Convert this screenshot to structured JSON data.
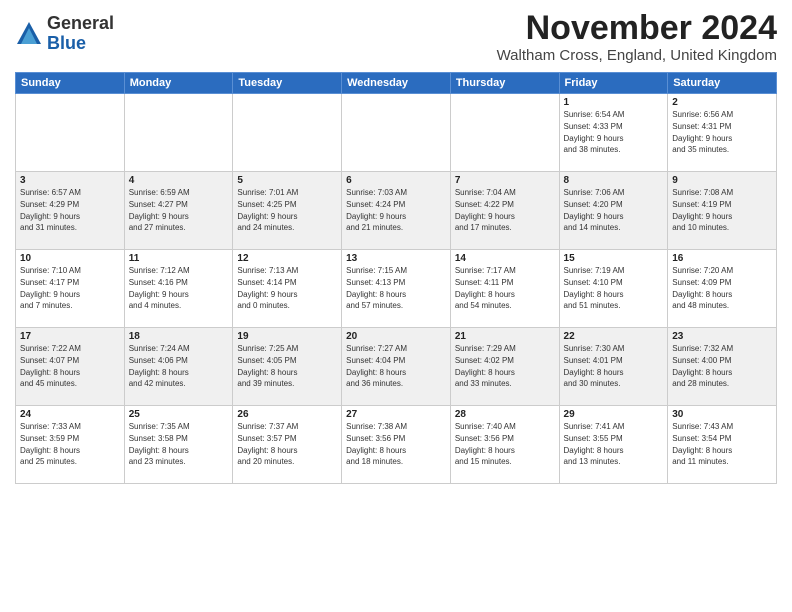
{
  "logo": {
    "general": "General",
    "blue": "Blue"
  },
  "title": "November 2024",
  "location": "Waltham Cross, England, United Kingdom",
  "headers": [
    "Sunday",
    "Monday",
    "Tuesday",
    "Wednesday",
    "Thursday",
    "Friday",
    "Saturday"
  ],
  "weeks": [
    [
      {
        "day": "",
        "info": ""
      },
      {
        "day": "",
        "info": ""
      },
      {
        "day": "",
        "info": ""
      },
      {
        "day": "",
        "info": ""
      },
      {
        "day": "",
        "info": ""
      },
      {
        "day": "1",
        "info": "Sunrise: 6:54 AM\nSunset: 4:33 PM\nDaylight: 9 hours\nand 38 minutes."
      },
      {
        "day": "2",
        "info": "Sunrise: 6:56 AM\nSunset: 4:31 PM\nDaylight: 9 hours\nand 35 minutes."
      }
    ],
    [
      {
        "day": "3",
        "info": "Sunrise: 6:57 AM\nSunset: 4:29 PM\nDaylight: 9 hours\nand 31 minutes."
      },
      {
        "day": "4",
        "info": "Sunrise: 6:59 AM\nSunset: 4:27 PM\nDaylight: 9 hours\nand 27 minutes."
      },
      {
        "day": "5",
        "info": "Sunrise: 7:01 AM\nSunset: 4:25 PM\nDaylight: 9 hours\nand 24 minutes."
      },
      {
        "day": "6",
        "info": "Sunrise: 7:03 AM\nSunset: 4:24 PM\nDaylight: 9 hours\nand 21 minutes."
      },
      {
        "day": "7",
        "info": "Sunrise: 7:04 AM\nSunset: 4:22 PM\nDaylight: 9 hours\nand 17 minutes."
      },
      {
        "day": "8",
        "info": "Sunrise: 7:06 AM\nSunset: 4:20 PM\nDaylight: 9 hours\nand 14 minutes."
      },
      {
        "day": "9",
        "info": "Sunrise: 7:08 AM\nSunset: 4:19 PM\nDaylight: 9 hours\nand 10 minutes."
      }
    ],
    [
      {
        "day": "10",
        "info": "Sunrise: 7:10 AM\nSunset: 4:17 PM\nDaylight: 9 hours\nand 7 minutes."
      },
      {
        "day": "11",
        "info": "Sunrise: 7:12 AM\nSunset: 4:16 PM\nDaylight: 9 hours\nand 4 minutes."
      },
      {
        "day": "12",
        "info": "Sunrise: 7:13 AM\nSunset: 4:14 PM\nDaylight: 9 hours\nand 0 minutes."
      },
      {
        "day": "13",
        "info": "Sunrise: 7:15 AM\nSunset: 4:13 PM\nDaylight: 8 hours\nand 57 minutes."
      },
      {
        "day": "14",
        "info": "Sunrise: 7:17 AM\nSunset: 4:11 PM\nDaylight: 8 hours\nand 54 minutes."
      },
      {
        "day": "15",
        "info": "Sunrise: 7:19 AM\nSunset: 4:10 PM\nDaylight: 8 hours\nand 51 minutes."
      },
      {
        "day": "16",
        "info": "Sunrise: 7:20 AM\nSunset: 4:09 PM\nDaylight: 8 hours\nand 48 minutes."
      }
    ],
    [
      {
        "day": "17",
        "info": "Sunrise: 7:22 AM\nSunset: 4:07 PM\nDaylight: 8 hours\nand 45 minutes."
      },
      {
        "day": "18",
        "info": "Sunrise: 7:24 AM\nSunset: 4:06 PM\nDaylight: 8 hours\nand 42 minutes."
      },
      {
        "day": "19",
        "info": "Sunrise: 7:25 AM\nSunset: 4:05 PM\nDaylight: 8 hours\nand 39 minutes."
      },
      {
        "day": "20",
        "info": "Sunrise: 7:27 AM\nSunset: 4:04 PM\nDaylight: 8 hours\nand 36 minutes."
      },
      {
        "day": "21",
        "info": "Sunrise: 7:29 AM\nSunset: 4:02 PM\nDaylight: 8 hours\nand 33 minutes."
      },
      {
        "day": "22",
        "info": "Sunrise: 7:30 AM\nSunset: 4:01 PM\nDaylight: 8 hours\nand 30 minutes."
      },
      {
        "day": "23",
        "info": "Sunrise: 7:32 AM\nSunset: 4:00 PM\nDaylight: 8 hours\nand 28 minutes."
      }
    ],
    [
      {
        "day": "24",
        "info": "Sunrise: 7:33 AM\nSunset: 3:59 PM\nDaylight: 8 hours\nand 25 minutes."
      },
      {
        "day": "25",
        "info": "Sunrise: 7:35 AM\nSunset: 3:58 PM\nDaylight: 8 hours\nand 23 minutes."
      },
      {
        "day": "26",
        "info": "Sunrise: 7:37 AM\nSunset: 3:57 PM\nDaylight: 8 hours\nand 20 minutes."
      },
      {
        "day": "27",
        "info": "Sunrise: 7:38 AM\nSunset: 3:56 PM\nDaylight: 8 hours\nand 18 minutes."
      },
      {
        "day": "28",
        "info": "Sunrise: 7:40 AM\nSunset: 3:56 PM\nDaylight: 8 hours\nand 15 minutes."
      },
      {
        "day": "29",
        "info": "Sunrise: 7:41 AM\nSunset: 3:55 PM\nDaylight: 8 hours\nand 13 minutes."
      },
      {
        "day": "30",
        "info": "Sunrise: 7:43 AM\nSunset: 3:54 PM\nDaylight: 8 hours\nand 11 minutes."
      }
    ]
  ]
}
